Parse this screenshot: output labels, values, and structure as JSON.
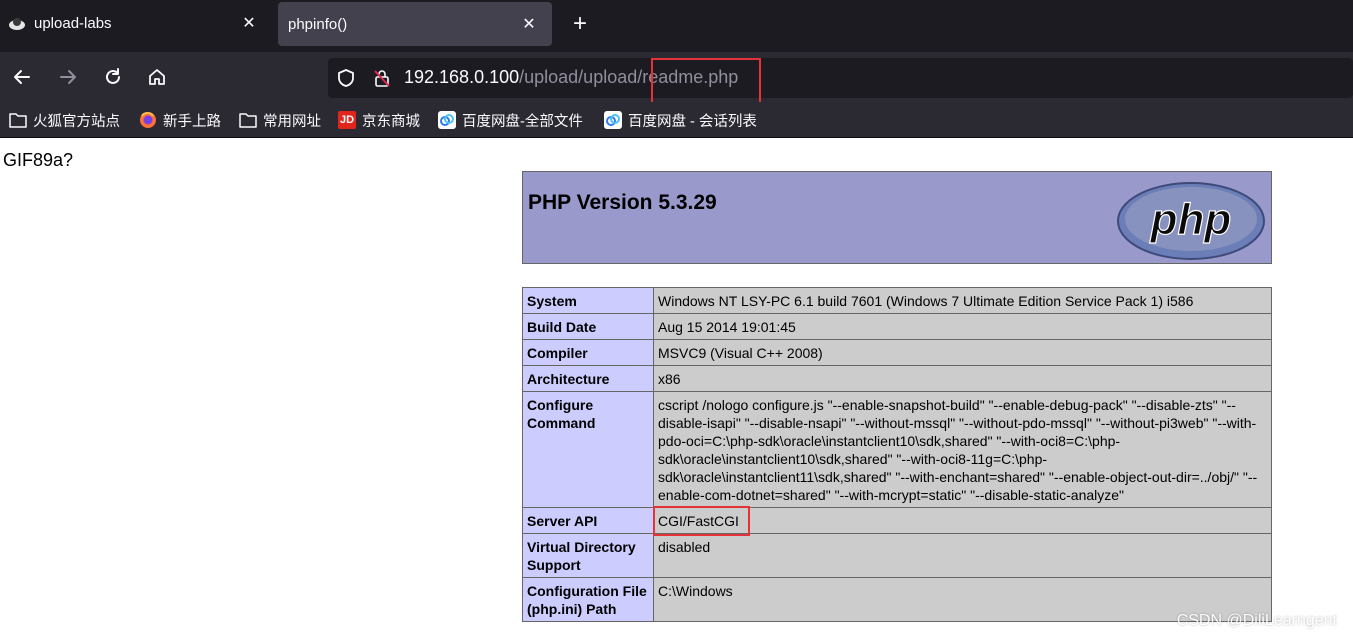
{
  "browser": {
    "tabs": [
      {
        "title": "upload-labs",
        "active": false
      },
      {
        "title": "phpinfo()",
        "active": true
      }
    ],
    "new_tab_label": "+",
    "close_label": "✕",
    "url": {
      "host": "192.168.0.100",
      "path": "/upload/upload/",
      "file": "readme.php"
    },
    "bookmarks": [
      {
        "label": "火狐官方站点",
        "icon": "folder-icon"
      },
      {
        "label": "新手上路",
        "icon": "firefox-icon"
      },
      {
        "label": "常用网址",
        "icon": "folder-icon"
      },
      {
        "label": "京东商城",
        "icon": "jd-icon"
      },
      {
        "label": "百度网盘-全部文件",
        "icon": "baidu-netdisk-icon"
      },
      {
        "label": "百度网盘 - 会话列表",
        "icon": "baidu-netdisk-icon"
      }
    ],
    "jd_icon_text": "JD"
  },
  "page": {
    "gif_header": "GIF89a?",
    "php_version": "PHP Version 5.3.29",
    "logo_text": "php",
    "rows": [
      {
        "key": "System",
        "value": "Windows NT LSY-PC 6.1 build 7601 (Windows 7 Ultimate Edition Service Pack 1) i586"
      },
      {
        "key": "Build Date",
        "value": "Aug 15 2014 19:01:45"
      },
      {
        "key": "Compiler",
        "value": "MSVC9 (Visual C++ 2008)"
      },
      {
        "key": "Architecture",
        "value": "x86"
      },
      {
        "key": "Configure Command",
        "value": "cscript /nologo configure.js \"--enable-snapshot-build\" \"--enable-debug-pack\" \"--disable-zts\" \"--disable-isapi\" \"--disable-nsapi\" \"--without-mssql\" \"--without-pdo-mssql\" \"--without-pi3web\" \"--with-pdo-oci=C:\\php-sdk\\oracle\\instantclient10\\sdk,shared\" \"--with-oci8=C:\\php-sdk\\oracle\\instantclient10\\sdk,shared\" \"--with-oci8-11g=C:\\php-sdk\\oracle\\instantclient11\\sdk,shared\" \"--with-enchant=shared\" \"--enable-object-out-dir=../obj/\" \"--enable-com-dotnet=shared\" \"--with-mcrypt=static\" \"--disable-static-analyze\""
      },
      {
        "key": "Server API",
        "value": "CGI/FastCGI"
      },
      {
        "key": "Virtual Directory Support",
        "value": "disabled"
      },
      {
        "key": "Configuration File (php.ini) Path",
        "value": "C:\\Windows"
      }
    ]
  },
  "watermark": "CSDN @DiliLearngent",
  "colors": {
    "highlight_box": "#e53238",
    "php_header_bg": "#9999cc",
    "key_cell_bg": "#ccccff",
    "value_cell_bg": "#cccccc"
  }
}
